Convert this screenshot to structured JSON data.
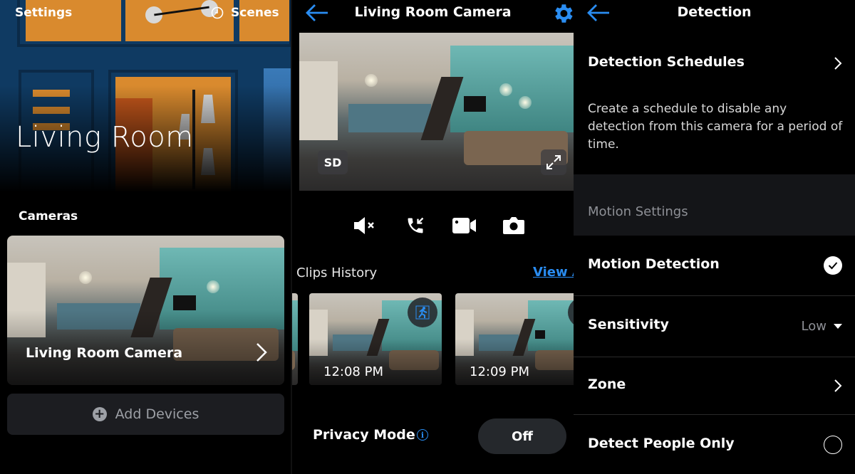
{
  "home": {
    "settings_label": "Settings",
    "scenes_label": "Scenes",
    "room_title": "Living Room",
    "section_label": "Cameras",
    "camera_card_label": "Living Room Camera",
    "add_devices_label": "Add Devices"
  },
  "camera": {
    "title": "Living Room Camera",
    "quality_badge": "SD",
    "controls": [
      {
        "icon": "mute-icon",
        "label": "Mute"
      },
      {
        "icon": "talk-icon",
        "label": "Talk"
      },
      {
        "icon": "record-icon",
        "label": "Record"
      },
      {
        "icon": "snapshot-icon",
        "label": "Snapshot"
      }
    ],
    "clips_label": "Clips History",
    "view_all_label": "View All",
    "clips": [
      {
        "time": "12:08 PM",
        "event": "motion"
      },
      {
        "time": "12:09 PM",
        "event": "motion"
      }
    ],
    "privacy_label": "Privacy Mode",
    "privacy_value": "Off"
  },
  "detection": {
    "title": "Detection",
    "schedules_label": "Detection Schedules",
    "schedules_desc": "Create a schedule to disable any detection from this camera for a period of time.",
    "group_label": "Motion Settings",
    "motion_detection_label": "Motion Detection",
    "motion_detection_enabled": true,
    "sensitivity_label": "Sensitivity",
    "sensitivity_value": "Low",
    "zone_label": "Zone",
    "people_only_label": "Detect People Only",
    "people_only_enabled": false
  },
  "colors": {
    "accent": "#2a8df2",
    "background": "#000000",
    "card": "#1c1d21",
    "muted_text": "#8e9096"
  }
}
